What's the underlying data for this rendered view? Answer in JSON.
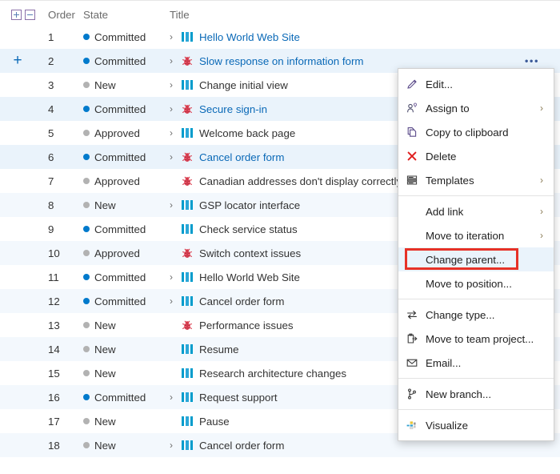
{
  "grid": {
    "header": {
      "expand_all_icon": "plus-square-icon",
      "collapse_all_icon": "minus-square-icon",
      "order": "Order",
      "state": "State",
      "title": "Title"
    },
    "rows": [
      {
        "order": "1",
        "state": "Committed",
        "state_color": "#007acc",
        "chevron": ">",
        "type": "story",
        "title": "Hello World Web Site",
        "link": true,
        "ellipsis": false,
        "selected": false,
        "gutter_plus": false
      },
      {
        "order": "2",
        "state": "Committed",
        "state_color": "#007acc",
        "chevron": ">",
        "type": "bug",
        "title": "Slow response on information form",
        "link": true,
        "ellipsis": true,
        "selected": true,
        "gutter_plus": true
      },
      {
        "order": "3",
        "state": "New",
        "state_color": "#b2b2b2",
        "chevron": ">",
        "type": "story",
        "title": "Change initial view",
        "link": false,
        "ellipsis": false,
        "selected": false,
        "gutter_plus": false
      },
      {
        "order": "4",
        "state": "Committed",
        "state_color": "#007acc",
        "chevron": ">",
        "type": "bug",
        "title": "Secure sign-in",
        "link": true,
        "ellipsis": true,
        "selected": true,
        "gutter_plus": false
      },
      {
        "order": "5",
        "state": "Approved",
        "state_color": "#b2b2b2",
        "chevron": ">",
        "type": "story",
        "title": "Welcome back page",
        "link": false,
        "ellipsis": false,
        "selected": false,
        "gutter_plus": false
      },
      {
        "order": "6",
        "state": "Committed",
        "state_color": "#007acc",
        "chevron": ">",
        "type": "bug",
        "title": "Cancel order form",
        "link": true,
        "ellipsis": true,
        "selected": true,
        "gutter_plus": false
      },
      {
        "order": "7",
        "state": "Approved",
        "state_color": "#b2b2b2",
        "chevron": "",
        "type": "bug",
        "title": "Canadian addresses don't display correctly",
        "link": false,
        "ellipsis": false,
        "selected": false,
        "gutter_plus": false
      },
      {
        "order": "8",
        "state": "New",
        "state_color": "#b2b2b2",
        "chevron": ">",
        "type": "story",
        "title": "GSP locator interface",
        "link": false,
        "ellipsis": false,
        "selected": false,
        "gutter_plus": false
      },
      {
        "order": "9",
        "state": "Committed",
        "state_color": "#007acc",
        "chevron": "",
        "type": "story",
        "title": "Check service status",
        "link": false,
        "ellipsis": false,
        "selected": false,
        "gutter_plus": false
      },
      {
        "order": "10",
        "state": "Approved",
        "state_color": "#b2b2b2",
        "chevron": "",
        "type": "bug",
        "title": "Switch context issues",
        "link": false,
        "ellipsis": false,
        "selected": false,
        "gutter_plus": false
      },
      {
        "order": "11",
        "state": "Committed",
        "state_color": "#007acc",
        "chevron": ">",
        "type": "story",
        "title": "Hello World Web Site",
        "link": false,
        "ellipsis": false,
        "selected": false,
        "gutter_plus": false
      },
      {
        "order": "12",
        "state": "Committed",
        "state_color": "#007acc",
        "chevron": ">",
        "type": "story",
        "title": "Cancel order form",
        "link": false,
        "ellipsis": false,
        "selected": false,
        "gutter_plus": false
      },
      {
        "order": "13",
        "state": "New",
        "state_color": "#b2b2b2",
        "chevron": "",
        "type": "bug",
        "title": "Performance issues",
        "link": false,
        "ellipsis": false,
        "selected": false,
        "gutter_plus": false
      },
      {
        "order": "14",
        "state": "New",
        "state_color": "#b2b2b2",
        "chevron": "",
        "type": "story",
        "title": "Resume",
        "link": false,
        "ellipsis": false,
        "selected": false,
        "gutter_plus": false
      },
      {
        "order": "15",
        "state": "New",
        "state_color": "#b2b2b2",
        "chevron": "",
        "type": "story",
        "title": "Research architecture changes",
        "link": false,
        "ellipsis": false,
        "selected": false,
        "gutter_plus": false
      },
      {
        "order": "16",
        "state": "Committed",
        "state_color": "#007acc",
        "chevron": ">",
        "type": "story",
        "title": "Request support",
        "link": false,
        "ellipsis": false,
        "selected": false,
        "gutter_plus": false
      },
      {
        "order": "17",
        "state": "New",
        "state_color": "#b2b2b2",
        "chevron": "",
        "type": "story",
        "title": "Pause",
        "link": false,
        "ellipsis": false,
        "selected": false,
        "gutter_plus": false
      },
      {
        "order": "18",
        "state": "New",
        "state_color": "#b2b2b2",
        "chevron": ">",
        "type": "story",
        "title": "Cancel order form",
        "link": false,
        "ellipsis": false,
        "selected": false,
        "gutter_plus": false
      }
    ],
    "ellipsis_label": "•••",
    "gutter_plus_label": "+"
  },
  "context_menu": {
    "highlight_color": "#e63127",
    "groups": [
      {
        "items": [
          {
            "label": "Edit...",
            "icon": "pencil-icon",
            "submenu": false,
            "highlighted": false
          },
          {
            "label": "Assign to",
            "icon": "person-assign-icon",
            "submenu": true,
            "highlighted": false
          },
          {
            "label": "Copy to clipboard",
            "icon": "copy-icon",
            "submenu": false,
            "highlighted": false
          },
          {
            "label": "Delete",
            "icon": "delete-x-icon",
            "submenu": false,
            "highlighted": false
          },
          {
            "label": "Templates",
            "icon": "templates-icon",
            "submenu": true,
            "highlighted": false
          }
        ]
      },
      {
        "items": [
          {
            "label": "Add link",
            "icon": "",
            "submenu": true,
            "highlighted": false
          },
          {
            "label": "Move to iteration",
            "icon": "",
            "submenu": true,
            "highlighted": false
          },
          {
            "label": "Change parent...",
            "icon": "",
            "submenu": false,
            "highlighted": true
          },
          {
            "label": "Move to position...",
            "icon": "",
            "submenu": false,
            "highlighted": false
          }
        ]
      },
      {
        "items": [
          {
            "label": "Change type...",
            "icon": "change-type-icon",
            "submenu": false,
            "highlighted": false
          },
          {
            "label": "Move to team project...",
            "icon": "move-project-icon",
            "submenu": false,
            "highlighted": false
          },
          {
            "label": "Email...",
            "icon": "email-icon",
            "submenu": false,
            "highlighted": false
          }
        ]
      },
      {
        "items": [
          {
            "label": "New branch...",
            "icon": "branch-icon",
            "submenu": false,
            "highlighted": false
          }
        ]
      },
      {
        "items": [
          {
            "label": "Visualize",
            "icon": "visualize-icon",
            "submenu": false,
            "highlighted": false
          }
        ]
      }
    ],
    "submenu_arrow": "›"
  }
}
